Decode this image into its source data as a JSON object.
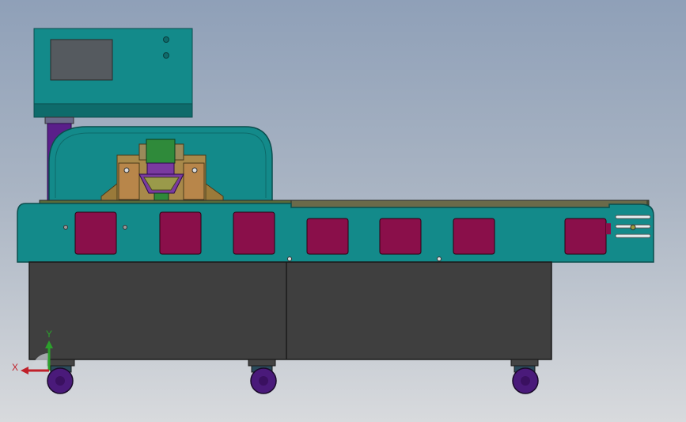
{
  "viewport": {
    "background_top": "#8fa0b8",
    "background_bottom": "#d8dadd"
  },
  "model": {
    "colors": {
      "teal": "#138a8a",
      "teal_dark": "#0e6b6b",
      "panel_maroon": "#8a0f4a",
      "cabinet_gray": "#3f3f3f",
      "purple": "#5a1f8a",
      "bronze": "#9a7a3a",
      "green_block": "#2f8a3a",
      "wheel_purple": "#4a1a7a"
    },
    "front_panels": 7,
    "casters": 3
  },
  "triad": {
    "x_label": "X",
    "y_label": "Y",
    "x_color": "#c0202a",
    "y_color": "#2ca02c"
  }
}
